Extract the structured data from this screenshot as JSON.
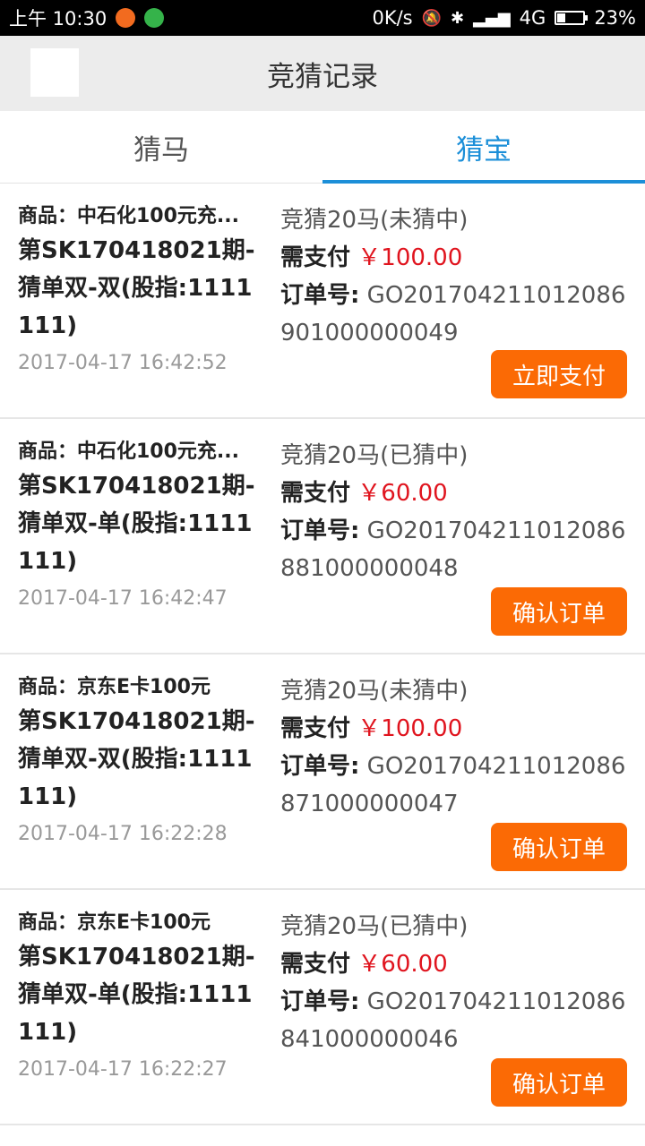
{
  "statusbar": {
    "time": "上午 10:30",
    "net_speed": "0K/s",
    "network": "4G",
    "battery": "23%"
  },
  "header": {
    "title": "竞猜记录"
  },
  "tabs": [
    {
      "label": "猜马",
      "active": false
    },
    {
      "label": "猜宝",
      "active": true
    }
  ],
  "records": [
    {
      "goods": "商品：中石化100元充...",
      "period": "第SK170418021期-猜单双-双(股指:1111111)",
      "time": "2017-04-17 16:42:52",
      "guess": "竞猜20马(未猜中)",
      "pay_label": "需支付",
      "pay_amount": "￥100.00",
      "order_label": "订单号:",
      "order_no": "GO201704211012086901000000049",
      "button": "立即支付"
    },
    {
      "goods": "商品：中石化100元充...",
      "period": "第SK170418021期-猜单双-单(股指:1111111)",
      "time": "2017-04-17 16:42:47",
      "guess": "竞猜20马(已猜中)",
      "pay_label": "需支付",
      "pay_amount": "￥60.00",
      "order_label": "订单号:",
      "order_no": "GO201704211012086881000000048",
      "button": "确认订单"
    },
    {
      "goods": "商品：京东E卡100元",
      "period": "第SK170418021期-猜单双-双(股指:1111111)",
      "time": "2017-04-17 16:22:28",
      "guess": "竞猜20马(未猜中)",
      "pay_label": "需支付",
      "pay_amount": "￥100.00",
      "order_label": "订单号:",
      "order_no": "GO201704211012086871000000047",
      "button": "确认订单"
    },
    {
      "goods": "商品：京东E卡100元",
      "period": "第SK170418021期-猜单双-单(股指:1111111)",
      "time": "2017-04-17 16:22:27",
      "guess": "竞猜20马(已猜中)",
      "pay_label": "需支付",
      "pay_amount": "￥60.00",
      "order_label": "订单号:",
      "order_no": "GO201704211012086841000000046",
      "button": "确认订单"
    }
  ],
  "colors": {
    "accent_blue": "#1c8fd8",
    "button_orange": "#fb6a05",
    "price_red": "#e0141e"
  }
}
